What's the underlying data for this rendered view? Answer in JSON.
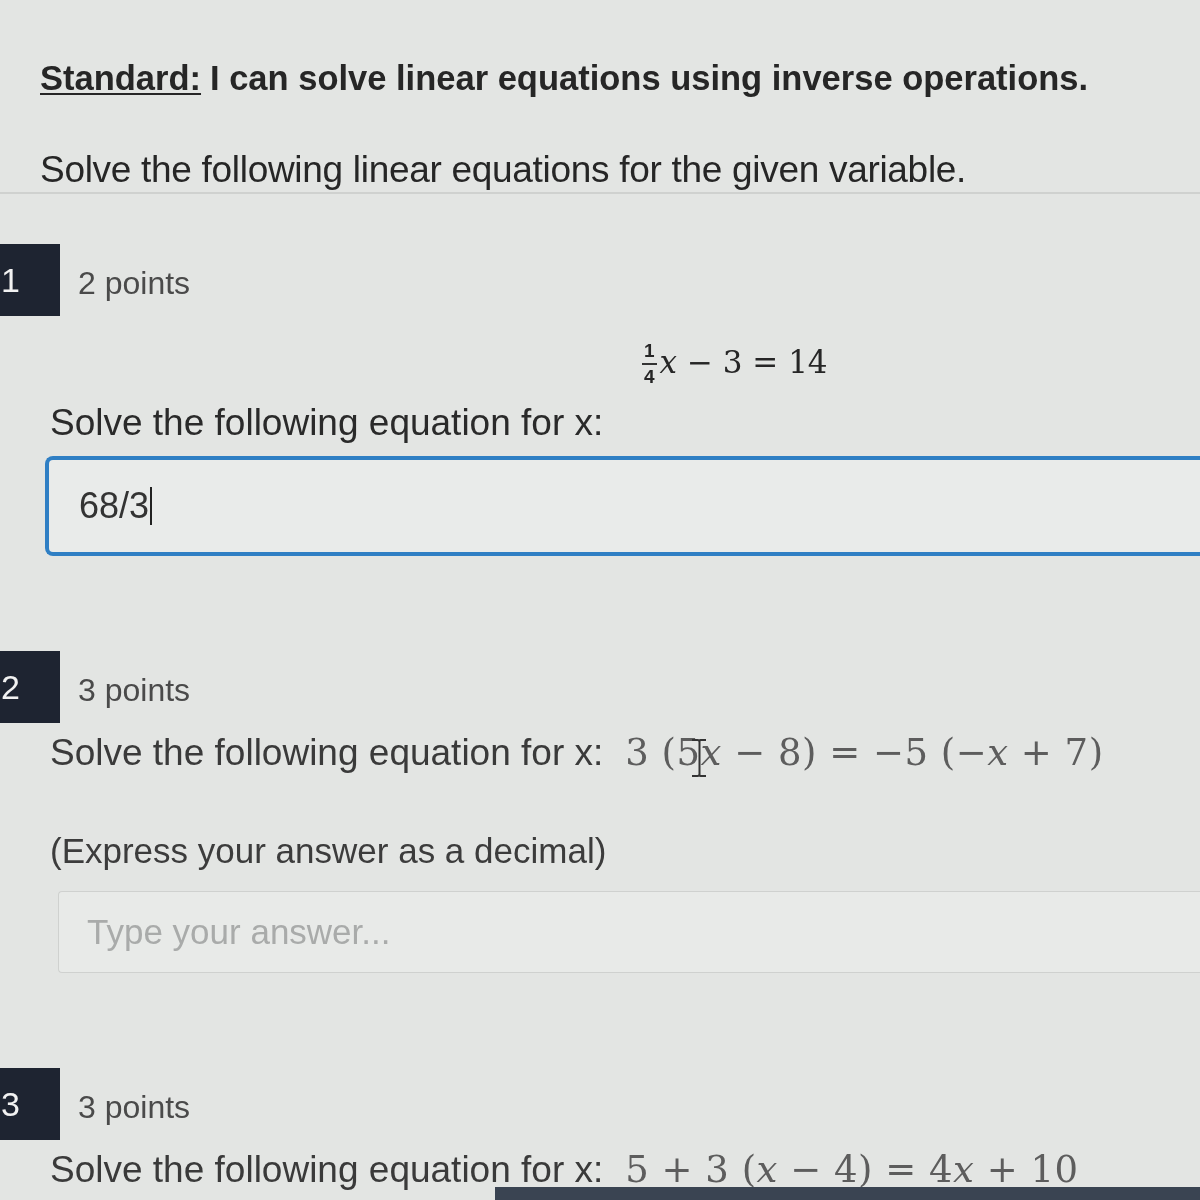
{
  "header": {
    "standard_label": "Standard:",
    "standard_text": "I can solve linear equations using inverse operations.",
    "instructions": "Solve the following linear equations for the given variable."
  },
  "questions": [
    {
      "number": "1",
      "points": "2 points",
      "kind": "display_equation",
      "equation": {
        "numerator": "1",
        "denominator": "4",
        "rest": [
          {
            "text": "x",
            "kind": "variable"
          },
          {
            "text": " − 3 = 14",
            "kind": "plain"
          }
        ]
      },
      "prompt": "Solve the following equation for x:",
      "answer": {
        "value": "68/3",
        "focused": true
      }
    },
    {
      "number": "2",
      "points": "3 points",
      "kind": "inline_equation",
      "prompt": "Solve the following equation for x:",
      "equation": [
        {
          "text": "3 (5",
          "kind": "plain"
        },
        {
          "text": "x",
          "kind": "variable"
        },
        {
          "text": " − 8) = −5 (−",
          "kind": "plain"
        },
        {
          "text": "x",
          "kind": "variable"
        },
        {
          "text": " + 7)",
          "kind": "plain"
        }
      ],
      "text_cursor": true,
      "note": "(Express your answer as a decimal)",
      "answer": {
        "placeholder": "Type your answer...",
        "focused": false
      }
    },
    {
      "number": "3",
      "points": "3 points",
      "kind": "inline_equation",
      "prompt": "Solve the following equation for x:",
      "equation": [
        {
          "text": "5 + 3 (",
          "kind": "plain"
        },
        {
          "text": "x",
          "kind": "variable"
        },
        {
          "text": " − 4) = 4",
          "kind": "plain"
        },
        {
          "text": "x",
          "kind": "variable"
        },
        {
          "text": " + 10",
          "kind": "plain"
        }
      ]
    }
  ]
}
